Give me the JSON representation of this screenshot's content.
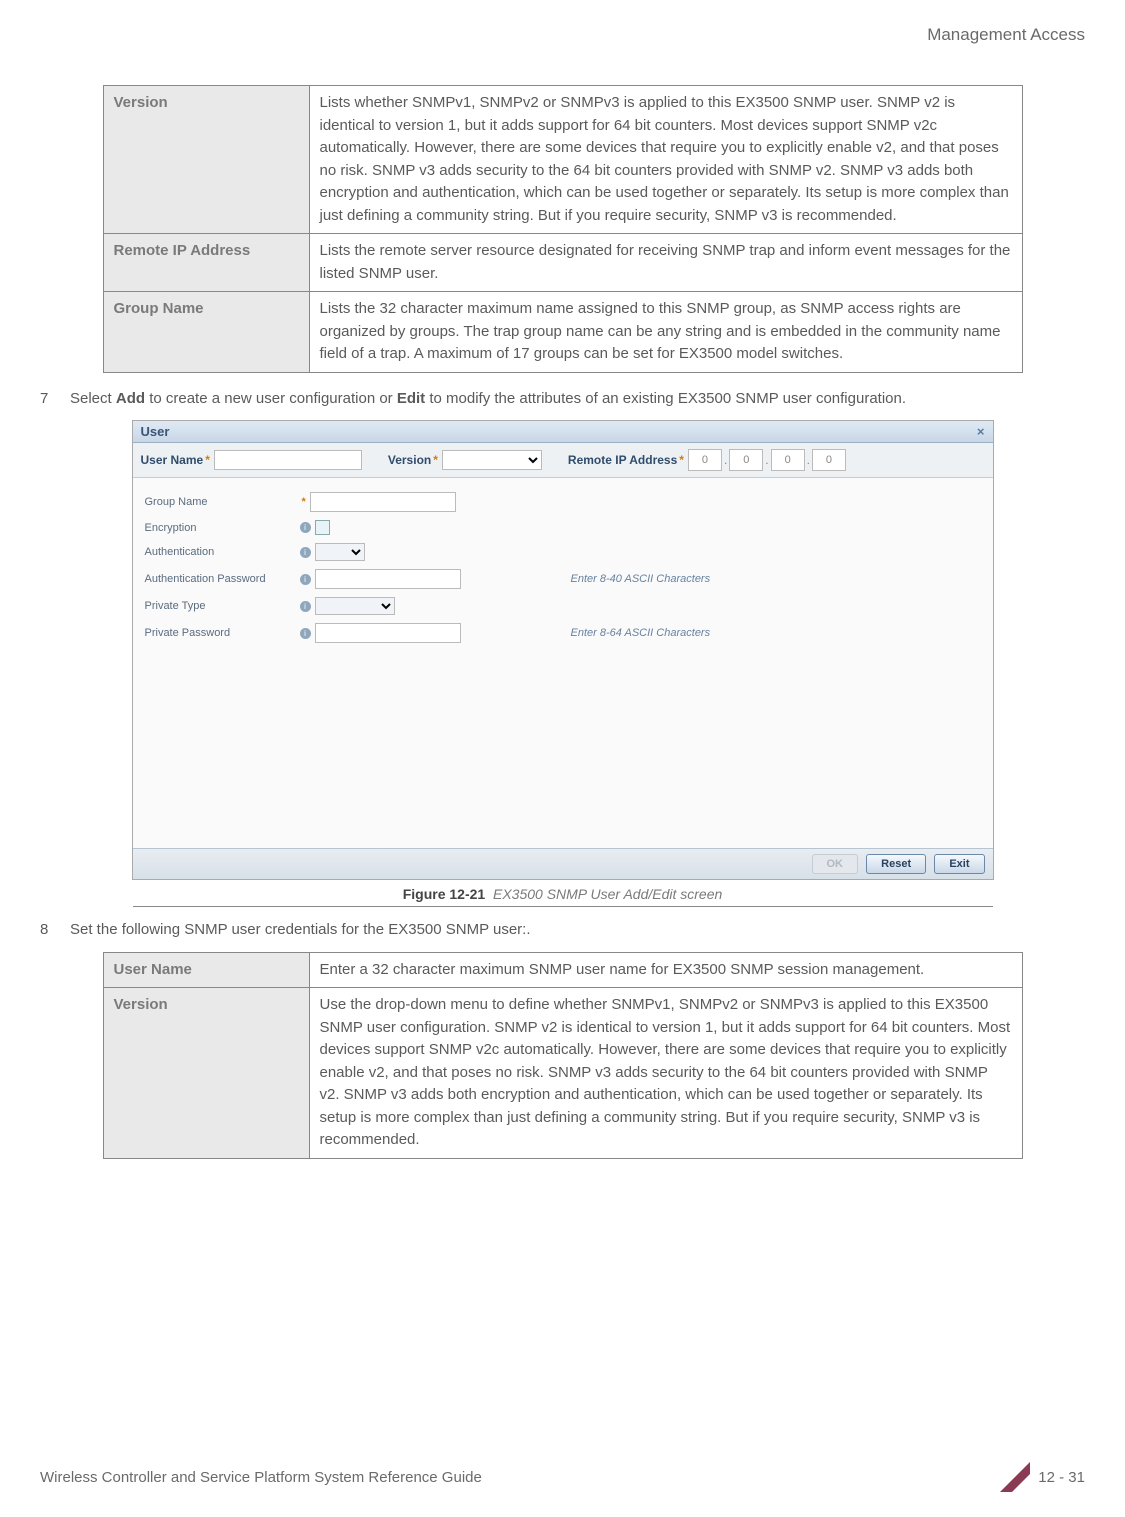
{
  "header": {
    "section": "Management Access"
  },
  "table1": {
    "rows": [
      {
        "label": "Version",
        "desc": "Lists whether SNMPv1, SNMPv2 or SNMPv3 is applied to this EX3500 SNMP user. SNMP v2 is identical to version 1, but it adds support for 64 bit counters. Most devices support SNMP v2c automatically. However, there are some devices that require you to explicitly enable v2, and that poses no risk. SNMP v3 adds security to the 64 bit counters provided with SNMP v2. SNMP v3 adds both encryption and authentication, which can be used together or separately. Its setup is more complex than just defining a community string. But if you require security, SNMP v3 is recommended."
      },
      {
        "label": "Remote IP Address",
        "desc": "Lists the remote server resource designated for receiving SNMP trap and inform event messages for the listed SNMP user."
      },
      {
        "label": "Group Name",
        "desc": "Lists the 32 character maximum name assigned to this SNMP group, as SNMP access rights are organized by groups. The trap group name can be any string and is embedded in the community name field of a trap. A maximum of 17 groups can be set for EX3500 model switches."
      }
    ]
  },
  "step7": {
    "num": "7",
    "pre": "Select ",
    "add": "Add",
    "mid": " to create a new user configuration or ",
    "edit": "Edit",
    "post": " to modify the attributes of an existing EX3500 SNMP user configuration."
  },
  "dialog": {
    "title": "User",
    "close": "×",
    "user_name_label": "User Name",
    "version_label": "Version",
    "remote_ip_label": "Remote IP Address",
    "ip_parts": [
      "0",
      "0",
      "0",
      "0"
    ],
    "fields": {
      "group_name": "Group Name",
      "encryption": "Encryption",
      "authentication": "Authentication",
      "auth_password": "Authentication Password",
      "auth_hint": "Enter 8-40 ASCII Characters",
      "private_type": "Private Type",
      "private_password": "Private Password",
      "priv_hint": "Enter 8-64 ASCII Characters"
    },
    "buttons": {
      "ok": "OK",
      "reset": "Reset",
      "exit": "Exit"
    }
  },
  "figure": {
    "label": "Figure 12-21",
    "caption": "EX3500 SNMP User Add/Edit screen"
  },
  "step8": {
    "num": "8",
    "text": "Set the following SNMP user credentials for the EX3500 SNMP user:."
  },
  "table2": {
    "rows": [
      {
        "label": "User Name",
        "desc": "Enter a 32 character maximum SNMP user name for EX3500 SNMP session management."
      },
      {
        "label": "Version",
        "desc": "Use the drop-down menu to define whether SNMPv1, SNMPv2 or SNMPv3 is applied to this EX3500 SNMP user configuration. SNMP v2 is identical to version 1, but it adds support for 64 bit counters. Most devices support SNMP v2c automatically. However, there are some devices that require you to explicitly enable v2, and that poses no risk. SNMP v3 adds security to the 64 bit counters provided with SNMP v2. SNMP v3 adds both encryption and authentication, which can be used together or separately. Its setup is more complex than just defining a community string. But if you require security, SNMP v3 is recommended."
      }
    ]
  },
  "footer": {
    "left": "Wireless Controller and Service Platform System Reference Guide",
    "right": "12 - 31"
  }
}
